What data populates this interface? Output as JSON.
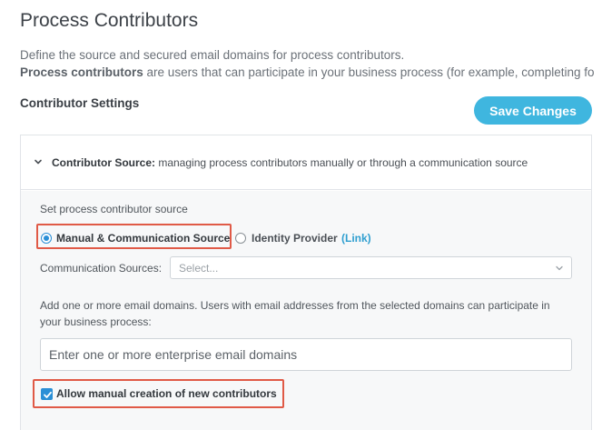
{
  "page": {
    "title": "Process Contributors",
    "description_line1": "Define the source and secured email domains for process contributors.",
    "description_line2_bold": "Process contributors",
    "description_line2_rest": " are users that can participate in your business process (for example, completing fo"
  },
  "settings": {
    "section_title": "Contributor Settings",
    "save_label": "Save Changes"
  },
  "panel": {
    "header_bold": "Contributor Source:",
    "header_text": " managing process contributors manually or through a communication source",
    "source_label": "Set process contributor source",
    "radio_options": [
      {
        "label": "Manual & Communication Source",
        "selected": true
      },
      {
        "label": "Identity Provider",
        "selected": false
      }
    ],
    "idp_link": "(Link)",
    "comm_sources_label": "Communication Sources:",
    "comm_sources_placeholder": "Select...",
    "domains_help": "Add one or more email domains. Users with email addresses from the selected domains can participate in your business process:",
    "domains_placeholder": "Enter one or more enterprise email domains",
    "allow_manual_label": "Allow manual creation of new contributors",
    "allow_manual_checked": true
  },
  "colors": {
    "accent": "#3fb6df",
    "checked": "#2b8fd6",
    "highlight": "#e05a47",
    "link": "#2f9fd0"
  },
  "icons": {
    "panel_toggle": "chevron-down-icon",
    "select_toggle": "select-chevron-icon",
    "checkbox_mark": "checkmark-icon"
  }
}
